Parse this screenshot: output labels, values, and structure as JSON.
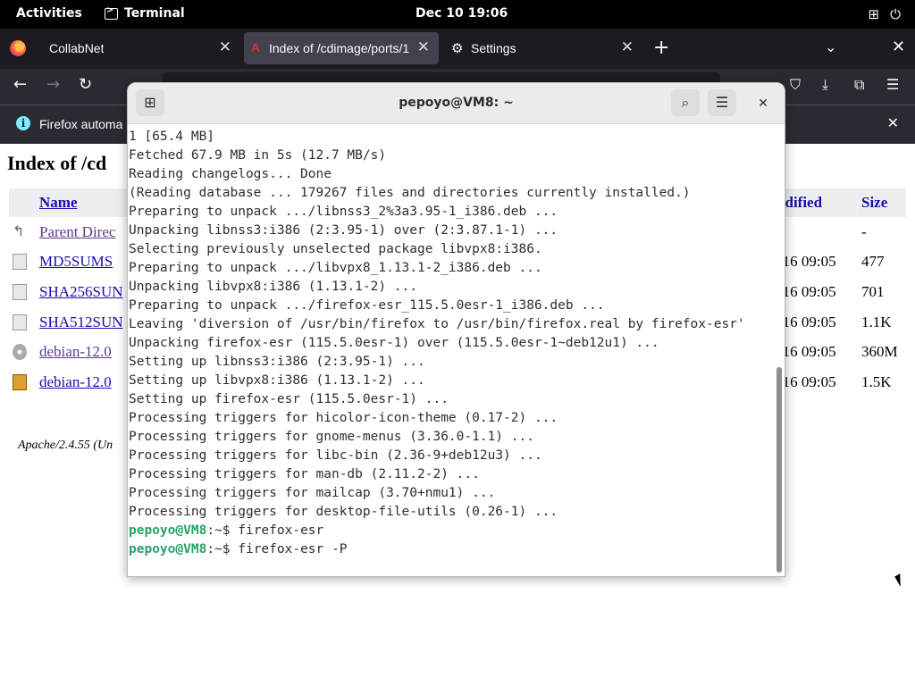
{
  "topbar": {
    "activities": "Activities",
    "app_name": "Terminal",
    "clock": "Dec 10  19:06",
    "network_icon": "network-icon",
    "power_icon": "power-icon"
  },
  "firefox": {
    "tabs": [
      {
        "label": "CollabNet",
        "active": false
      },
      {
        "label": "Index of /cdimage/ports/1",
        "active": true
      },
      {
        "label": "Settings",
        "active": false
      }
    ],
    "notice_text": "Firefox automa",
    "page": {
      "title": "Index of /cd",
      "columns": {
        "name": "Name",
        "modified": "odified",
        "size": "Size"
      },
      "rows": [
        {
          "name": "Parent Direc",
          "date": "",
          "size": "-",
          "icon": "back-icon"
        },
        {
          "name": "MD5SUMS",
          "date": "-16 09:05",
          "size": "477",
          "icon": "text-file-icon"
        },
        {
          "name": "SHA256SUN",
          "date": "-16 09:05",
          "size": "701",
          "icon": "text-file-icon"
        },
        {
          "name": "SHA512SUN",
          "date": "-16 09:05",
          "size": "1.1K",
          "icon": "text-file-icon"
        },
        {
          "name": "debian-12.0",
          "date": "-16 09:05",
          "size": "360M",
          "icon": "disc-image-icon"
        },
        {
          "name": "debian-12.0",
          "date": "-16 09:05",
          "size": "1.5K",
          "icon": "archive-icon"
        }
      ],
      "footer": "Apache/2.4.55 (Un"
    }
  },
  "terminal": {
    "title": "pepoyo@VM8: ~",
    "lines": [
      "1 [65.4 MB]",
      "Fetched 67.9 MB in 5s (12.7 MB/s)",
      "Reading changelogs... Done",
      "(Reading database ... 179267 files and directories currently installed.)",
      "Preparing to unpack .../libnss3_2%3a3.95-1_i386.deb ...",
      "Unpacking libnss3:i386 (2:3.95-1) over (2:3.87.1-1) ...",
      "Selecting previously unselected package libvpx8:i386.",
      "Preparing to unpack .../libvpx8_1.13.1-2_i386.deb ...",
      "Unpacking libvpx8:i386 (1.13.1-2) ...",
      "Preparing to unpack .../firefox-esr_115.5.0esr-1_i386.deb ...",
      "Leaving 'diversion of /usr/bin/firefox to /usr/bin/firefox.real by firefox-esr'",
      "Unpacking firefox-esr (115.5.0esr-1) over (115.5.0esr-1~deb12u1) ...",
      "Setting up libnss3:i386 (2:3.95-1) ...",
      "Setting up libvpx8:i386 (1.13.1-2) ...",
      "Setting up firefox-esr (115.5.0esr-1) ...",
      "Processing triggers for hicolor-icon-theme (0.17-2) ...",
      "Processing triggers for gnome-menus (3.36.0-1.1) ...",
      "Processing triggers for libc-bin (2.36-9+deb12u3) ...",
      "Processing triggers for man-db (2.11.2-2) ...",
      "Processing triggers for mailcap (3.70+nmu1) ...",
      "Processing triggers for desktop-file-utils (0.26-1) ..."
    ],
    "prompt_lines": [
      {
        "prompt": "pepoyo@VM8",
        "suffix": ":~$ ",
        "command": "firefox-esr"
      },
      {
        "prompt": "pepoyo@VM8",
        "suffix": ":~$ ",
        "command": "firefox-esr -P"
      }
    ]
  }
}
